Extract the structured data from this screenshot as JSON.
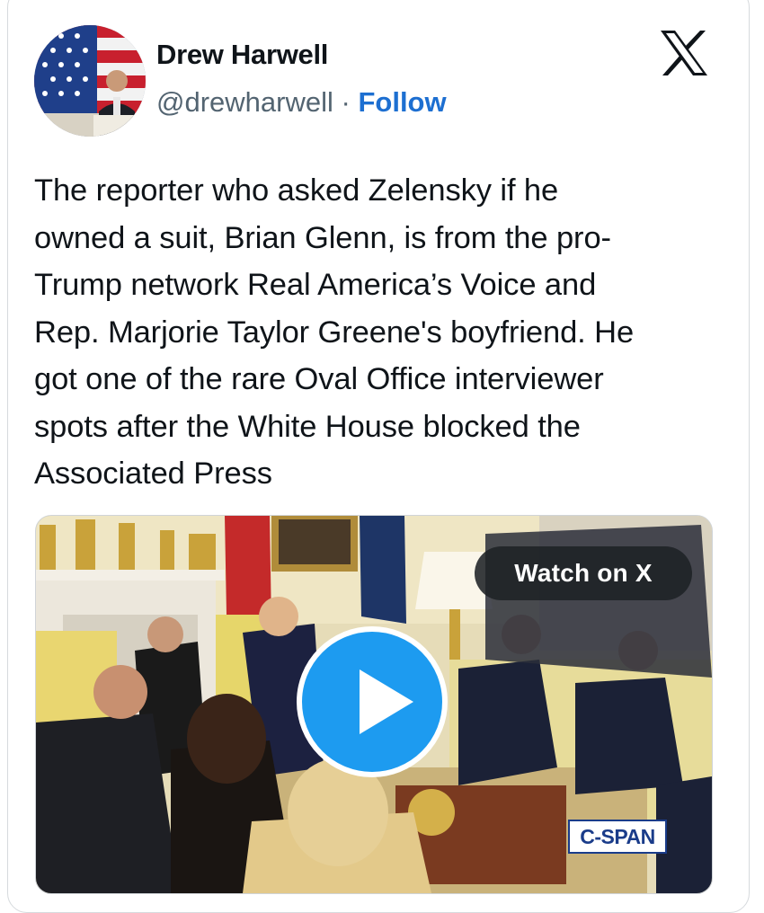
{
  "author": {
    "name": "Drew Harwell",
    "handle": "@drewharwell",
    "separator": "·",
    "follow_label": "Follow"
  },
  "platform": {
    "icon": "x-logo-icon"
  },
  "tweet": {
    "lines": [
      "The reporter who asked Zelensky if he",
      "owned a suit, Brian Glenn, is from the pro-",
      "Trump network Real America’s Voice and",
      "Rep. Marjorie Taylor Greene's boyfriend. He",
      "got one of the rare Oval Office interviewer",
      "spots after the White House blocked the",
      "Associated Press"
    ]
  },
  "media": {
    "watch_label": "Watch on X",
    "play_icon": "play-icon",
    "channel_logo": "C-SPAN",
    "colors": {
      "play": "#1d9bf0",
      "pill": "#1e2226",
      "follow": "#1d6fd1"
    }
  }
}
